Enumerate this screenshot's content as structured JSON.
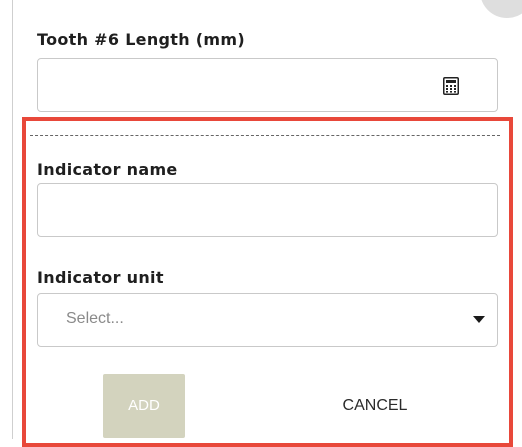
{
  "tooth_field": {
    "label": "Tooth #6 Length (mm)",
    "value": "",
    "icon": "calculator-icon"
  },
  "indicator_form": {
    "name_label": "Indicator name",
    "name_value": "",
    "unit_label": "Indicator unit",
    "unit_placeholder": "Select...",
    "unit_icon": "caret-down-icon",
    "add_label": "ADD",
    "cancel_label": "CANCEL",
    "highlight_color": "#e8483a",
    "add_button_color": "#d3d3be"
  }
}
